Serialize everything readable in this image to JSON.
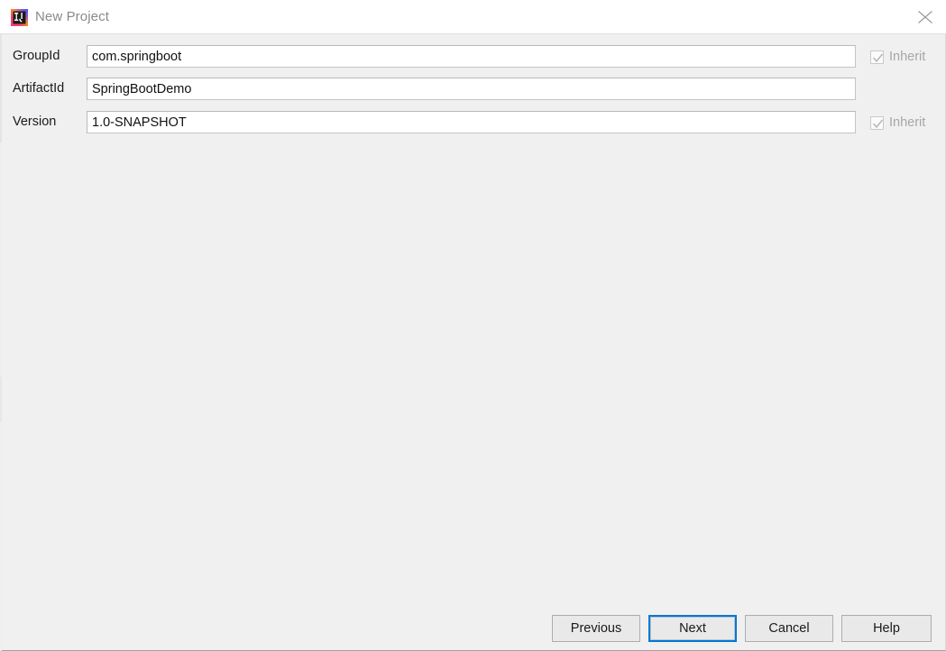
{
  "window": {
    "title": "New Project",
    "app_icon": "intellij-idea-logo-icon",
    "close_icon": "close-icon",
    "background_color": "#f0f0f0",
    "titlebar_color": "#ffffff",
    "accent_color": "#0078d7"
  },
  "form": {
    "fields": [
      {
        "label": "GroupId",
        "value": "com.springboot",
        "placeholder": "",
        "inherit": {
          "label": "Inherit",
          "checked": true,
          "enabled": false
        }
      },
      {
        "label": "ArtifactId",
        "value": "SpringBootDemo",
        "placeholder": "",
        "inherit": null
      },
      {
        "label": "Version",
        "value": "1.0-SNAPSHOT",
        "placeholder": "",
        "inherit": {
          "label": "Inherit",
          "checked": true,
          "enabled": false
        }
      }
    ]
  },
  "buttons": {
    "previous": "Previous",
    "next": "Next",
    "cancel": "Cancel",
    "help": "Help",
    "focused": "Next"
  }
}
